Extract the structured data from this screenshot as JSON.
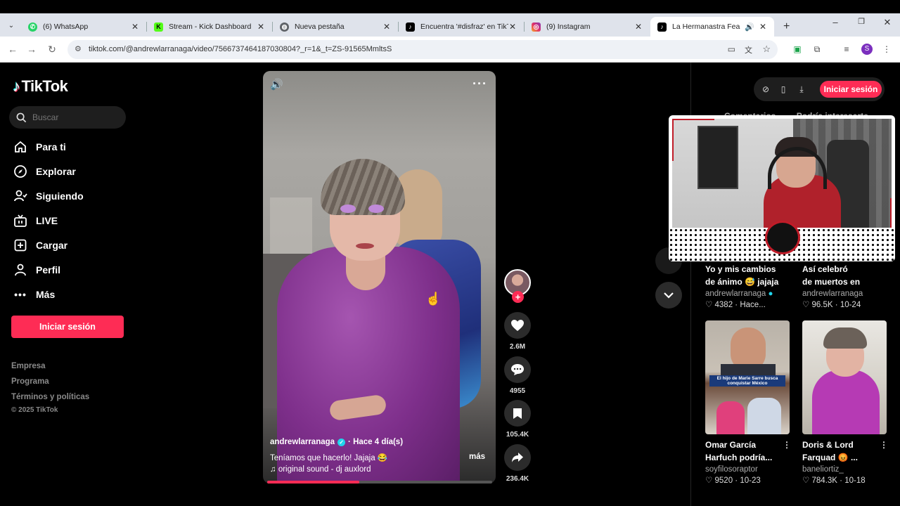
{
  "browser": {
    "tabs": [
      {
        "title": "(6) WhatsApp",
        "favicon_color": "#25d366",
        "favicon_icon": "whatsapp-icon"
      },
      {
        "title": "Stream - Kick Dashboard",
        "favicon_color": "#53fc18",
        "favicon_icon": "kick-icon"
      },
      {
        "title": "Nueva pestaña",
        "favicon_color": "#5f6368",
        "favicon_icon": "globe-icon"
      },
      {
        "title": "Encuentra '#disfraz' en TikTok",
        "favicon_color": "#000000",
        "favicon_icon": "tiktok-icon"
      },
      {
        "title": "(9) Instagram",
        "favicon_color": "#e1306c",
        "favicon_icon": "instagram-icon"
      },
      {
        "title": "La Hermanastra Fea y Ot",
        "favicon_color": "#000000",
        "favicon_icon": "tiktok-icon",
        "active": true
      }
    ],
    "new_tab": "+",
    "url": "tiktok.com/@andrewlarranaga/video/7566737464187030804?_r=1&_t=ZS-91565MmltsS",
    "window_controls": [
      "–",
      "❐",
      "✕"
    ]
  },
  "sidebar": {
    "logo": "TikTok",
    "search_placeholder": "Buscar",
    "nav": [
      {
        "label": "Para ti",
        "icon": "home-icon"
      },
      {
        "label": "Explorar",
        "icon": "compass-icon"
      },
      {
        "label": "Siguiendo",
        "icon": "following-icon"
      },
      {
        "label": "LIVE",
        "icon": "live-icon"
      },
      {
        "label": "Cargar",
        "icon": "upload-icon"
      },
      {
        "label": "Perfil",
        "icon": "profile-icon"
      },
      {
        "label": "Más",
        "icon": "more-icon"
      }
    ],
    "login_button": "Iniciar sesión",
    "footer": [
      "Empresa",
      "Programa",
      "Términos y políticas",
      "© 2025 TikTok"
    ]
  },
  "video": {
    "author": "andrewlarranaga",
    "posted": "· Hace 4 día(s)",
    "description": "Teníamos que hacerlo! Jajaja 😂",
    "more_label": "más",
    "music": "♫ original sound - dj auxlord",
    "progress": 0.41
  },
  "actions": {
    "likes": "2.6M",
    "comments": "4955",
    "saves": "105.4K",
    "shares": "236.4K"
  },
  "right_panel": {
    "login_button": "Iniciar sesión",
    "tabs": [
      "Comentarios",
      "Podría interesarte"
    ],
    "cards": [
      {
        "title_line1": "Yo y mis cambios",
        "title_line2": "de ánimo 😅 jajaja",
        "user": "andrewlarranaga",
        "likes": "4382",
        "date": "Hace..."
      },
      {
        "title_line1": "Así celebró",
        "title_line2": "de muertos en",
        "user": "andrewlarranaga",
        "likes": "96.5K",
        "date": "10-24"
      },
      {
        "title_line1": "Omar García",
        "title_line2": "Harfuch podría...",
        "user": "soyfilosoraptor",
        "likes": "9520",
        "date": "10-23",
        "thumb_caption": "El hijo de Marie Sarre busca conquistar México"
      },
      {
        "title_line1": "Doris & Lord",
        "title_line2": "Farquad 😡 ...",
        "user": "baneliortiz_",
        "likes": "784.3K",
        "date": "10-18"
      }
    ]
  },
  "colors": {
    "accent": "#fe2c55",
    "verified": "#20d5ec"
  }
}
